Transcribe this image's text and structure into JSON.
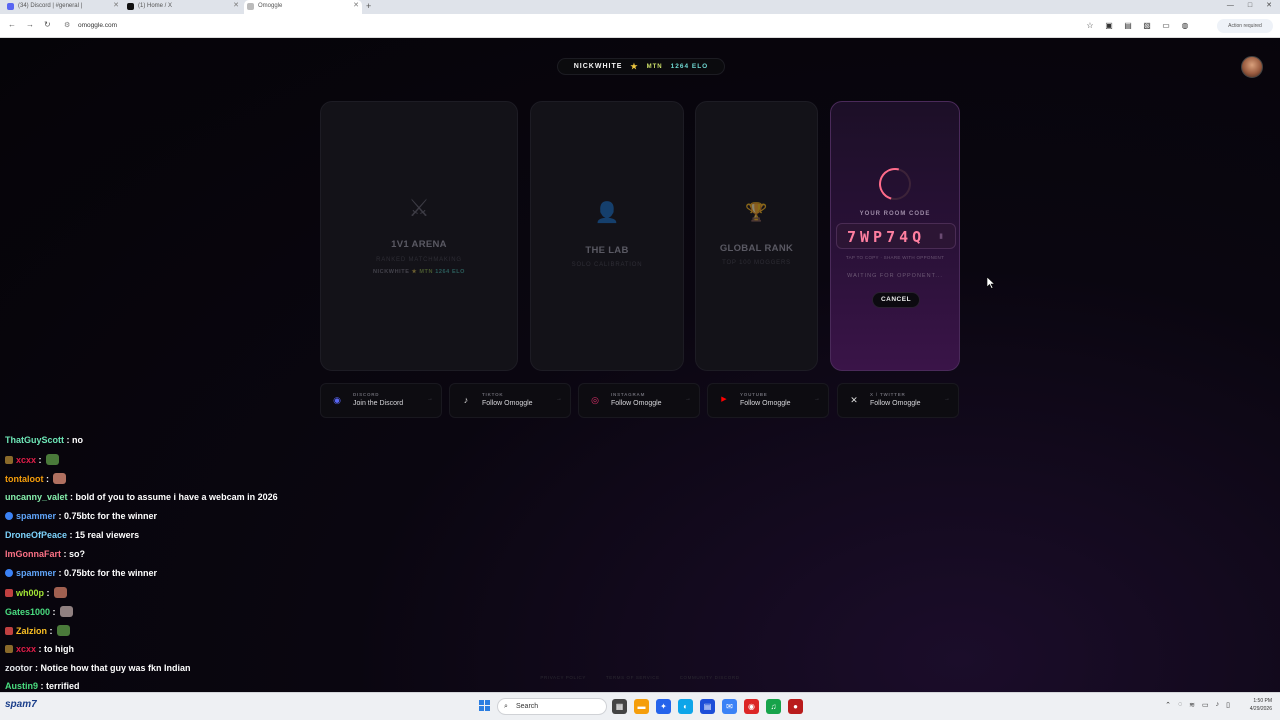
{
  "browser": {
    "tabs": [
      {
        "label": "(34) Discord | #general |",
        "color": "#5865f2"
      },
      {
        "label": "(1) Home / X",
        "color": "#111111"
      },
      {
        "label": "Omoggle",
        "color": "#bbbbbb"
      }
    ],
    "new_tab": "+",
    "url": "omoggle.com",
    "action_required": "Action required"
  },
  "header": {
    "username": "NICKWHITE",
    "rank": "MTN",
    "elo": "1264 ELO"
  },
  "cards": [
    {
      "icon": "crossed-swords-icon",
      "glyph": "⚔",
      "title": "1V1 ARENA",
      "subtitle": "RANKED MATCHMAKING",
      "mini_user": "NICKWHITE",
      "mini_rank": "MTN",
      "mini_elo": "1264 ELO"
    },
    {
      "icon": "person-icon",
      "glyph": "👤",
      "title": "THE LAB",
      "subtitle": "SOLO CALIBRATION"
    },
    {
      "icon": "trophy-icon",
      "glyph": "🏆",
      "title": "GLOBAL RANK",
      "subtitle": "TOP 100 MOGGERS"
    }
  ],
  "room": {
    "label": "YOUR ROOM CODE",
    "code": "7WP74Q",
    "hint": "TAP TO COPY · SHARE WITH OPPONENT",
    "waiting": "WAITING FOR OPPONENT...",
    "cancel": "CANCEL"
  },
  "socials": [
    {
      "icon": "discord-icon",
      "glyph": "◉",
      "color": "#5865f2",
      "label": "DISCORD",
      "text": "Join the Discord"
    },
    {
      "icon": "tiktok-icon",
      "glyph": "♪",
      "color": "#ffffff",
      "label": "TIKTOK",
      "text": "Follow Omoggle"
    },
    {
      "icon": "instagram-icon",
      "glyph": "◎",
      "color": "#e1306c",
      "label": "INSTAGRAM",
      "text": "Follow Omoggle"
    },
    {
      "icon": "youtube-icon",
      "glyph": "▶",
      "color": "#ff0000",
      "label": "YOUTUBE",
      "text": "Follow Omoggle"
    },
    {
      "icon": "x-icon",
      "glyph": "✕",
      "color": "#ffffff",
      "label": "X / TWITTER",
      "text": "Follow Omoggle"
    }
  ],
  "footer": [
    "PRIVACY POLICY",
    "TERMS OF SERVICE",
    "COMMUNITY DISCORD"
  ],
  "chat": [
    {
      "user": "ThatGuyScott",
      "color": "#6ee7b7",
      "text": "no"
    },
    {
      "user": "xcxx",
      "color": "#e11d48",
      "text": "",
      "emote": "#4a7a3a",
      "badge": "#8a6a2a"
    },
    {
      "user": "tontaloot",
      "color": "#f59e0b",
      "text": "",
      "emote": "#b07060"
    },
    {
      "user": "uncanny_valet",
      "color": "#86efac",
      "text": "bold of you to assume i have a webcam in 2026"
    },
    {
      "user": "spammer",
      "color": "#60a5fa",
      "text": "0.75btc for the winner",
      "badge": "#3b82f6"
    },
    {
      "user": "DroneOfPeace",
      "color": "#7dd3fc",
      "text": "15 real viewers"
    },
    {
      "user": "ImGonnaFart",
      "color": "#fb7185",
      "text": "so?"
    },
    {
      "user": "spammer",
      "color": "#60a5fa",
      "text": "0.75btc for the winner",
      "badge": "#3b82f6"
    },
    {
      "user": "wh00p",
      "color": "#a3e635",
      "text": "",
      "emote": "#a06050",
      "badge": "#c04040"
    },
    {
      "user": "Gates1000",
      "color": "#4ade80",
      "text": "",
      "emote": "#908080"
    },
    {
      "user": "Zalzion",
      "color": "#fbbf24",
      "text": "",
      "emote": "#4a7a3a",
      "badge": "#c04040"
    },
    {
      "user": "xcxx",
      "color": "#e11d48",
      "text": "to high",
      "badge": "#8a6a2a"
    },
    {
      "user": "zootor",
      "color": "#e5e7eb",
      "text": "Notice how that guy was fkn Indian"
    },
    {
      "user": "Austin9",
      "color": "#4ade80",
      "text": "terrified"
    }
  ],
  "taskbar": {
    "left_label": "spam7",
    "search": "Search",
    "time": "1:50 PM",
    "date": "4/29/2026"
  }
}
